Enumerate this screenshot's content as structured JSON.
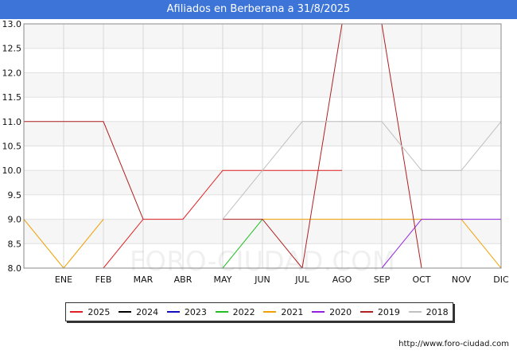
{
  "title": "Afiliados en Berberana a 31/8/2025",
  "source": "http://www.foro-ciudad.com",
  "watermark": "FORO-CIUDAD.COM",
  "chart_data": {
    "type": "line",
    "title": "Afiliados en Berberana a 31/8/2025",
    "xlabel": "",
    "ylabel": "",
    "x": [
      "",
      "ENE",
      "FEB",
      "MAR",
      "ABR",
      "MAY",
      "JUN",
      "JUL",
      "AGO",
      "SEP",
      "OCT",
      "NOV",
      "DIC"
    ],
    "xticks": [
      "ENE",
      "FEB",
      "MAR",
      "ABR",
      "MAY",
      "JUN",
      "JUL",
      "AGO",
      "SEP",
      "OCT",
      "NOV",
      "DIC"
    ],
    "yticks": [
      "8.0",
      "8.5",
      "9.0",
      "9.5",
      "10.0",
      "10.5",
      "11.0",
      "11.5",
      "12.0",
      "12.5",
      "13.0"
    ],
    "ylim": [
      8,
      13
    ],
    "grid": true,
    "legend_position": "bottom",
    "series": [
      {
        "name": "2025",
        "color": "#e02020",
        "values": [
          null,
          null,
          8,
          9,
          9,
          10,
          10,
          10,
          10,
          null,
          null,
          null,
          null
        ]
      },
      {
        "name": "2024",
        "color": "#000000",
        "values": [
          null,
          null,
          null,
          null,
          null,
          null,
          null,
          null,
          null,
          null,
          null,
          null,
          null
        ]
      },
      {
        "name": "2023",
        "color": "#1010c0",
        "values": [
          null,
          null,
          null,
          null,
          null,
          null,
          null,
          null,
          null,
          null,
          null,
          null,
          null
        ]
      },
      {
        "name": "2022",
        "color": "#20c020",
        "values": [
          null,
          null,
          null,
          null,
          null,
          8,
          9,
          null,
          null,
          null,
          null,
          null,
          null
        ]
      },
      {
        "name": "2021",
        "color": "#f0a000",
        "values": [
          9,
          8,
          9,
          null,
          null,
          null,
          9,
          9,
          9,
          9,
          9,
          9,
          8
        ]
      },
      {
        "name": "2020",
        "color": "#9020e0",
        "values": [
          null,
          null,
          null,
          null,
          null,
          null,
          null,
          null,
          null,
          8,
          9,
          9,
          9
        ]
      },
      {
        "name": "2019",
        "color": "#b02020",
        "values": [
          11,
          11,
          11,
          9,
          null,
          9,
          9,
          8,
          13,
          13,
          8,
          null,
          null
        ]
      },
      {
        "name": "2018",
        "color": "#c0c0c0",
        "values": [
          null,
          null,
          null,
          null,
          null,
          9,
          10,
          11,
          11,
          11,
          10,
          10,
          11
        ]
      }
    ]
  }
}
